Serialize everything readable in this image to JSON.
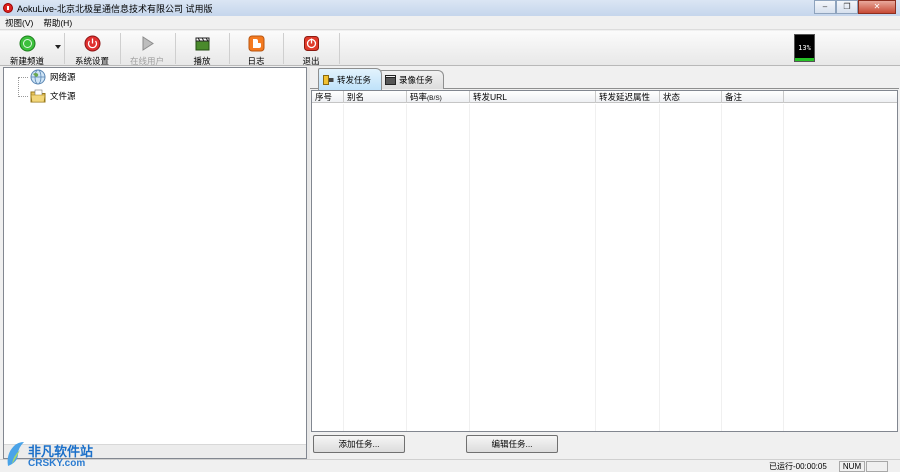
{
  "window": {
    "title": "AokuLive-北京北极星通信息技术有限公司 试用版",
    "minimize_glyph": "–",
    "restore_glyph": "❐",
    "close_glyph": "✕"
  },
  "menu": {
    "items": [
      {
        "label": "视图(V)"
      },
      {
        "label": "帮助(H)"
      }
    ]
  },
  "toolbar": {
    "new_channel": "新建频道",
    "settings": "系统设置",
    "online_users": "在线用户",
    "play": "播放",
    "log": "日志",
    "exit": "退出",
    "new_channel_icon": "green-circle-icon",
    "settings_icon": "red-power-icon",
    "online_users_icon": "play-arrow-icon",
    "play_icon": "clapperboard-icon",
    "log_icon": "orange-blog-icon",
    "exit_icon": "red-stop-icon"
  },
  "meter": {
    "label": "13%",
    "percent": 13,
    "fill_color": "#26c226"
  },
  "tree": {
    "items": [
      {
        "label": "网络源",
        "icon": "globe-icon"
      },
      {
        "label": "文件源",
        "icon": "folder-file-icon"
      }
    ]
  },
  "tabs": [
    {
      "label": "转发任务",
      "icon": "forward-task-icon",
      "active": true
    },
    {
      "label": "录像任务",
      "icon": "camera-record-icon",
      "active": false
    }
  ],
  "grid": {
    "columns": [
      {
        "label": "序号"
      },
      {
        "label": "别名"
      },
      {
        "label": "码率",
        "unit": "(B/S)"
      },
      {
        "label": "转发URL"
      },
      {
        "label": "转发延迟属性"
      },
      {
        "label": "状态"
      },
      {
        "label": "备注"
      }
    ]
  },
  "buttons": {
    "add_task": "添加任务...",
    "edit_task": "编辑任务..."
  },
  "status": {
    "runtime": "已运行-00:00:05",
    "num": "NUM"
  },
  "watermark": {
    "line1": "非凡软件站",
    "line2": "CRSKY.com"
  }
}
